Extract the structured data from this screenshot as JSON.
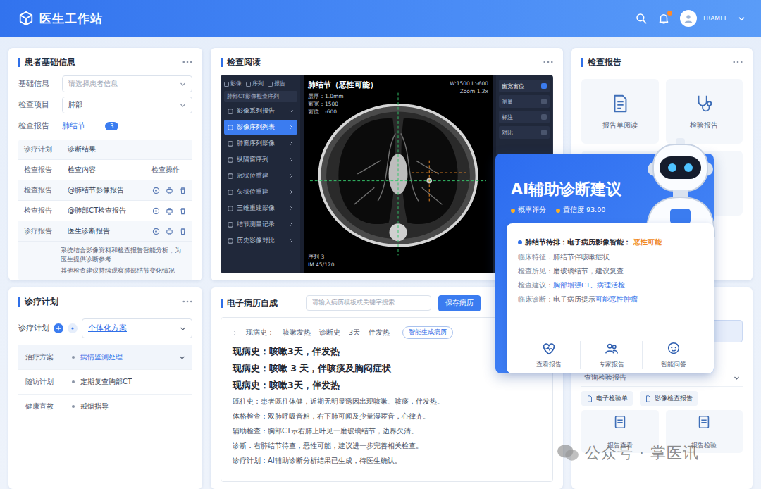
{
  "header": {
    "title": "医生工作站",
    "user": "TRAMEF",
    "unread": true
  },
  "patient": {
    "title": "患者基础信息",
    "fields": [
      {
        "label": "基础信息",
        "kind": "select",
        "value": "请选择患者信息",
        "placeholder": true,
        "badge": ""
      },
      {
        "label": "检查项目",
        "kind": "select",
        "value": "肺部",
        "placeholder": false,
        "badge": ""
      },
      {
        "label": "检查报告",
        "kind": "tag",
        "value": "肺结节",
        "placeholder": false,
        "badge": "3"
      }
    ],
    "rows": [
      {
        "label": "诊疗计划",
        "value": "诊断结果",
        "extra": "",
        "actions": false
      },
      {
        "label": "检查报告",
        "value": "检查内容",
        "extra": "检查操作",
        "actions": false
      },
      {
        "label": "检查报告",
        "value": "@肺结节影像报告",
        "extra": "",
        "actions": true
      },
      {
        "label": "检查报告",
        "value": "@肺部CT检查报告",
        "extra": "",
        "actions": true
      },
      {
        "label": "诊疗报告",
        "value": "医生诊断报告",
        "extra": "",
        "actions": true
      }
    ],
    "notes": [
      "系统结合影像资料和检查报告智能分析，为医生提供诊断参考",
      "其他检查建议持续观察肺部结节变化情况"
    ]
  },
  "viewer": {
    "title": "检查阅读",
    "toolbar": [
      "影像",
      "序列",
      "报告"
    ],
    "search": "肺部CT影像检查序列",
    "series": [
      {
        "label": "影像系列报告",
        "selected": false,
        "expanded": true
      },
      {
        "label": "影像序列列表",
        "selected": true,
        "expanded": false
      },
      {
        "label": "肺窗序列影像",
        "selected": false,
        "expanded": false
      },
      {
        "label": "纵隔窗序列",
        "selected": false,
        "expanded": false
      },
      {
        "label": "冠状位重建",
        "selected": false,
        "expanded": false
      },
      {
        "label": "矢状位重建",
        "selected": false,
        "expanded": false
      },
      {
        "label": "三维重建影像",
        "selected": false,
        "expanded": false
      },
      {
        "label": "结节测量记录",
        "selected": false,
        "expanded": false
      },
      {
        "label": "历史影像对比",
        "selected": false,
        "expanded": false
      }
    ],
    "image": {
      "label": "肺结节（恶性可能）",
      "info": [
        "层厚：1.0mm",
        "窗宽：1500",
        "窗位：-600"
      ],
      "footer": [
        "序列 3",
        "IM 45/120"
      ],
      "right_info": [
        "W:1500 L:-600",
        "Zoom 1.2x"
      ]
    },
    "tools": [
      {
        "label": "窗宽窗位",
        "selected": true
      },
      {
        "label": "测量",
        "selected": false
      },
      {
        "label": "标注",
        "selected": false
      },
      {
        "label": "对比",
        "selected": false
      }
    ]
  },
  "reports": {
    "title": "检查报告",
    "tiles": [
      "报告单阅读",
      "检验报告"
    ]
  },
  "plan": {
    "title": "诊疗计划",
    "label": "诊疗计划",
    "value": "个体化方案",
    "items": [
      {
        "label": "治疗方案",
        "value": "病情监测处理",
        "selected": true
      },
      {
        "label": "随访计划",
        "value": "定期复查胸部CT",
        "selected": false
      },
      {
        "label": "健康宣教",
        "value": "戒烟指导",
        "selected": false
      }
    ]
  },
  "emr": {
    "title": "电子病历自成",
    "search": "请输入病历模板或关键字搜索",
    "button": "保存病历",
    "tags": [
      "现病史：",
      "咳嗽发热",
      "诊断史",
      "3天",
      "伴发热"
    ],
    "generate": "智能生成病历",
    "headings": [
      "现病史：咳嗽3天，伴发热",
      "现病史：咳嗽 3 天，伴咳痰及胸闷症状",
      "现病史：咳嗽3天，伴发热"
    ],
    "paragraphs": [
      "既往史：患者既往体健，近期无明显诱因出现咳嗽、咳痰，伴发热。",
      "体格检查：双肺呼吸音粗，右下肺可闻及少量湿啰音，心律齐。",
      "辅助检查：胸部CT示右肺上叶见一磨玻璃结节，边界欠清。",
      "诊断：右肺结节待查，恶性可能，建议进一步完善相关检查。",
      "诊疗计划：AI辅助诊断分析结果已生成，待医生确认。"
    ]
  },
  "side": {
    "query": "查询检验报告",
    "chips": [
      "电子检验单",
      "影像检查报告"
    ],
    "tiles": [
      "报告查看",
      "报告检验"
    ]
  },
  "ai": {
    "title": "AI辅助诊断建议",
    "meta": [
      "概率评分",
      "置信度 93.00"
    ],
    "headline": "肺结节待排：电子病历影像智能：",
    "headline_highlight": "恶性可能",
    "lines": [
      {
        "label": "临床特征：",
        "text": "肺结节伴咳嗽症状",
        "highlight": ""
      },
      {
        "label": "检查所见：",
        "text": "磨玻璃结节，建议复查",
        "highlight": ""
      },
      {
        "label": "检查建议：",
        "text": "",
        "highlight": "胸部增强CT、病理活检"
      },
      {
        "label": "临床诊断：",
        "text": "电子病历提示",
        "highlight": "可能恶性肿瘤"
      }
    ],
    "actions": [
      "查看报告",
      "专家报告",
      "智能问答"
    ]
  },
  "watermark": "公众号 · 掌医讯"
}
